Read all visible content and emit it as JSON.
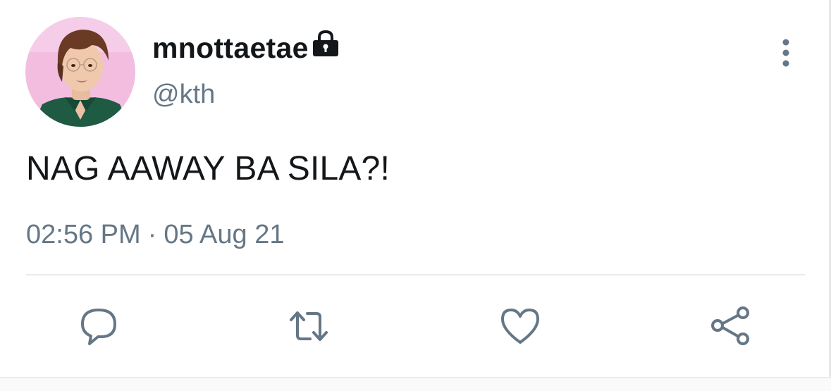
{
  "author": {
    "display_name": "mnottaetae",
    "handle": "@kth",
    "protected_icon": "lock-icon",
    "avatar": "profile-photo"
  },
  "tweet": {
    "text": "NAG AAWAY BA SILA?!",
    "time": "02:56 PM",
    "separator": "·",
    "date": "05 Aug 21"
  },
  "actions": {
    "reply_icon": "speech-bubble-icon",
    "retweet_icon": "retweet-arrows-icon",
    "like_icon": "heart-icon",
    "share_icon": "share-nodes-icon",
    "more_icon": "vertical-ellipsis-icon"
  },
  "colors": {
    "text_primary": "#14171a",
    "text_secondary": "#657786",
    "divider": "#e6ecf0",
    "avatar_background": "#f2b8df"
  }
}
